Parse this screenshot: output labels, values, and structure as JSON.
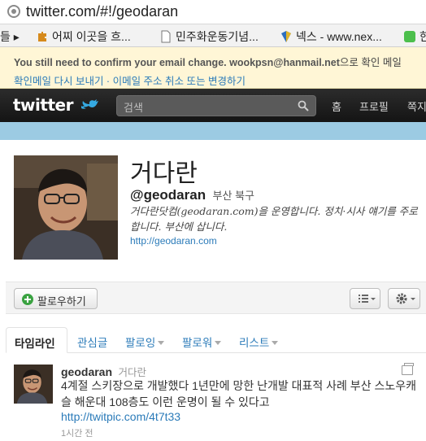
{
  "browser": {
    "url": "twitter.com/#!/geodaran",
    "bookmarks": [
      {
        "label": "들 ▸"
      },
      {
        "label": "어찌 이곳을 흐..."
      },
      {
        "label": "민주화운동기념..."
      },
      {
        "label": "넥스 - www.nex..."
      },
      {
        "label": "한"
      }
    ]
  },
  "notice": {
    "line1_bold": "You still need to confirm your email change. wookpsn@hanmail.net",
    "line1_rest": "으로 확인 메일",
    "resend_link": "확인메일 다시 보내기",
    "separator": " · ",
    "cancel_link": "이메일 주소 취소 또는 변경하기"
  },
  "topbar": {
    "logo": "twitter",
    "search_placeholder": "검색",
    "nav": [
      "홈",
      "프로필",
      "쪽지"
    ]
  },
  "colors": {
    "link": "#2b7bb9",
    "band": "#9ccbe3",
    "topbar": "#1b1b1b",
    "notice_bg": "#fff6d6"
  },
  "profile": {
    "name": "거다란",
    "handle": "@geodaran",
    "location": "부산 북구",
    "bio": "거다란닷컴(geodaran.com)을 운영합니다. 정치·시사 얘기를 주로 합니다. 부산에 삽니다.",
    "website": "http://geodaran.com"
  },
  "actions": {
    "follow_label": "팔로우하기",
    "list_icon": "list-icon",
    "gear_icon": "gear-icon"
  },
  "tabs": [
    {
      "label": "타임라인",
      "active": true
    },
    {
      "label": "관심글"
    },
    {
      "label": "팔로잉"
    },
    {
      "label": "팔로워"
    },
    {
      "label": "리스트"
    }
  ],
  "tweet": {
    "username": "geodaran",
    "display_name": "거다란",
    "text": "4계절 스키장으로 개발했다 1년만에 망한 난개발 대표적 사례 부산 스노우캐슬 해운대 108층도 이런 운명이 될 수 있다고",
    "link": "http://twitpic.com/4t7t33",
    "time": "1시간 전"
  }
}
